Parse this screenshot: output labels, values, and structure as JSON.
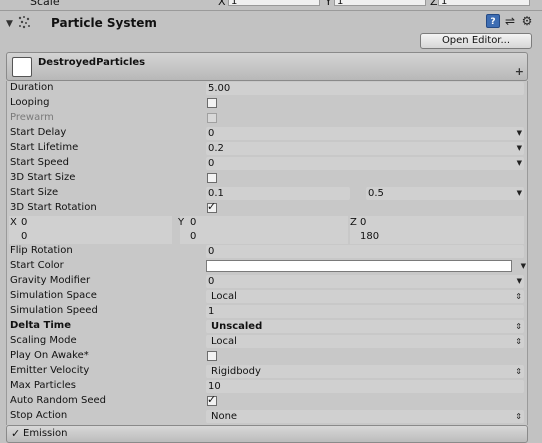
{
  "top_row": {
    "label": "Scale",
    "x_label": "X",
    "x_value": "1",
    "y_label": "Y",
    "y_value": "1",
    "z_label": "Z",
    "z_value": "1"
  },
  "component": {
    "title": "Particle System",
    "open_editor_label": "Open Editor...",
    "icons": [
      "help-icon",
      "settings-sliders-icon",
      "gear-icon"
    ]
  },
  "module": {
    "title": "DestroyedParticles",
    "plus_symbol": "+"
  },
  "properties": {
    "duration": {
      "label": "Duration",
      "value": "5.00"
    },
    "looping": {
      "label": "Looping",
      "checked": false
    },
    "prewarm": {
      "label": "Prewarm",
      "checked": false,
      "disabled": true
    },
    "start_delay": {
      "label": "Start Delay",
      "value": "0"
    },
    "start_lifetime": {
      "label": "Start Lifetime",
      "value": "0.2"
    },
    "start_speed": {
      "label": "Start Speed",
      "value": "0"
    },
    "start_size_3d": {
      "label": "3D Start Size",
      "checked": false
    },
    "start_size": {
      "label": "Start Size",
      "min": "0.1",
      "max": "0.5"
    },
    "start_rotation_3d": {
      "label": "3D Start Rotation",
      "checked": true
    },
    "rotation": {
      "x_label": "X",
      "x_top": "0",
      "x_bottom": "0",
      "y_label": "Y",
      "y_top": "0",
      "y_bottom": "0",
      "z_label": "Z",
      "z_top": "0",
      "z_bottom": "180"
    },
    "flip_rotation": {
      "label": "Flip Rotation",
      "value": "0"
    },
    "start_color": {
      "label": "Start Color",
      "color": "#ffffff"
    },
    "gravity_modifier": {
      "label": "Gravity Modifier",
      "value": "0"
    },
    "simulation_space": {
      "label": "Simulation Space",
      "value": "Local"
    },
    "simulation_speed": {
      "label": "Simulation Speed",
      "value": "1"
    },
    "delta_time": {
      "label": "Delta Time",
      "value": "Unscaled"
    },
    "scaling_mode": {
      "label": "Scaling Mode",
      "value": "Local"
    },
    "play_on_awake": {
      "label": "Play On Awake*",
      "checked": false
    },
    "emitter_velocity": {
      "label": "Emitter Velocity",
      "value": "Rigidbody"
    },
    "max_particles": {
      "label": "Max Particles",
      "value": "10"
    },
    "auto_random_seed": {
      "label": "Auto Random Seed",
      "checked": true
    },
    "stop_action": {
      "label": "Stop Action",
      "value": "None"
    }
  },
  "emission": {
    "title": "Emission",
    "checked": true
  }
}
